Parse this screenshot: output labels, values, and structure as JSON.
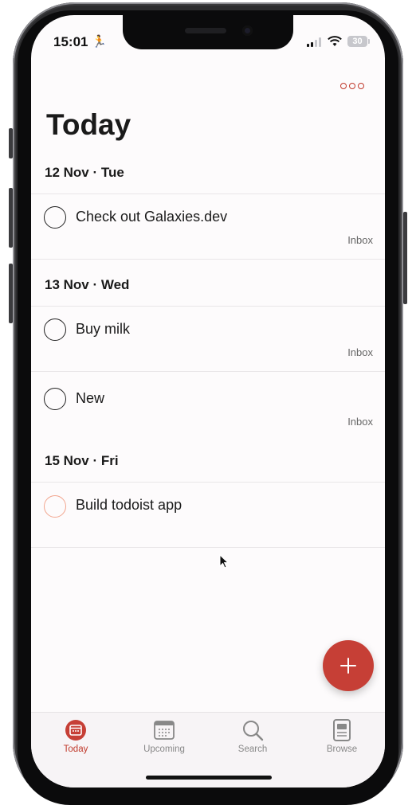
{
  "status": {
    "time": "15:01",
    "battery": "30"
  },
  "page": {
    "title": "Today"
  },
  "sections": [
    {
      "header": "12 Nov · Tue",
      "tasks": [
        {
          "text": "Check out Galaxies.dev",
          "project": "Inbox"
        }
      ]
    },
    {
      "header": "13 Nov · Wed",
      "tasks": [
        {
          "text": "Buy milk",
          "project": "Inbox"
        },
        {
          "text": "New",
          "project": "Inbox"
        }
      ]
    },
    {
      "header": "15 Nov · Fri",
      "tasks": [
        {
          "text": "Build todoist app",
          "project": ""
        }
      ]
    }
  ],
  "tabs": [
    {
      "label": "Today",
      "icon": "calendar-today-icon",
      "active": true
    },
    {
      "label": "Upcoming",
      "icon": "calendar-grid-icon",
      "active": false
    },
    {
      "label": "Search",
      "icon": "search-icon",
      "active": false
    },
    {
      "label": "Browse",
      "icon": "browse-icon",
      "active": false
    }
  ],
  "colors": {
    "accent": "#c63f36",
    "priority_circle": "#f2a58e"
  }
}
